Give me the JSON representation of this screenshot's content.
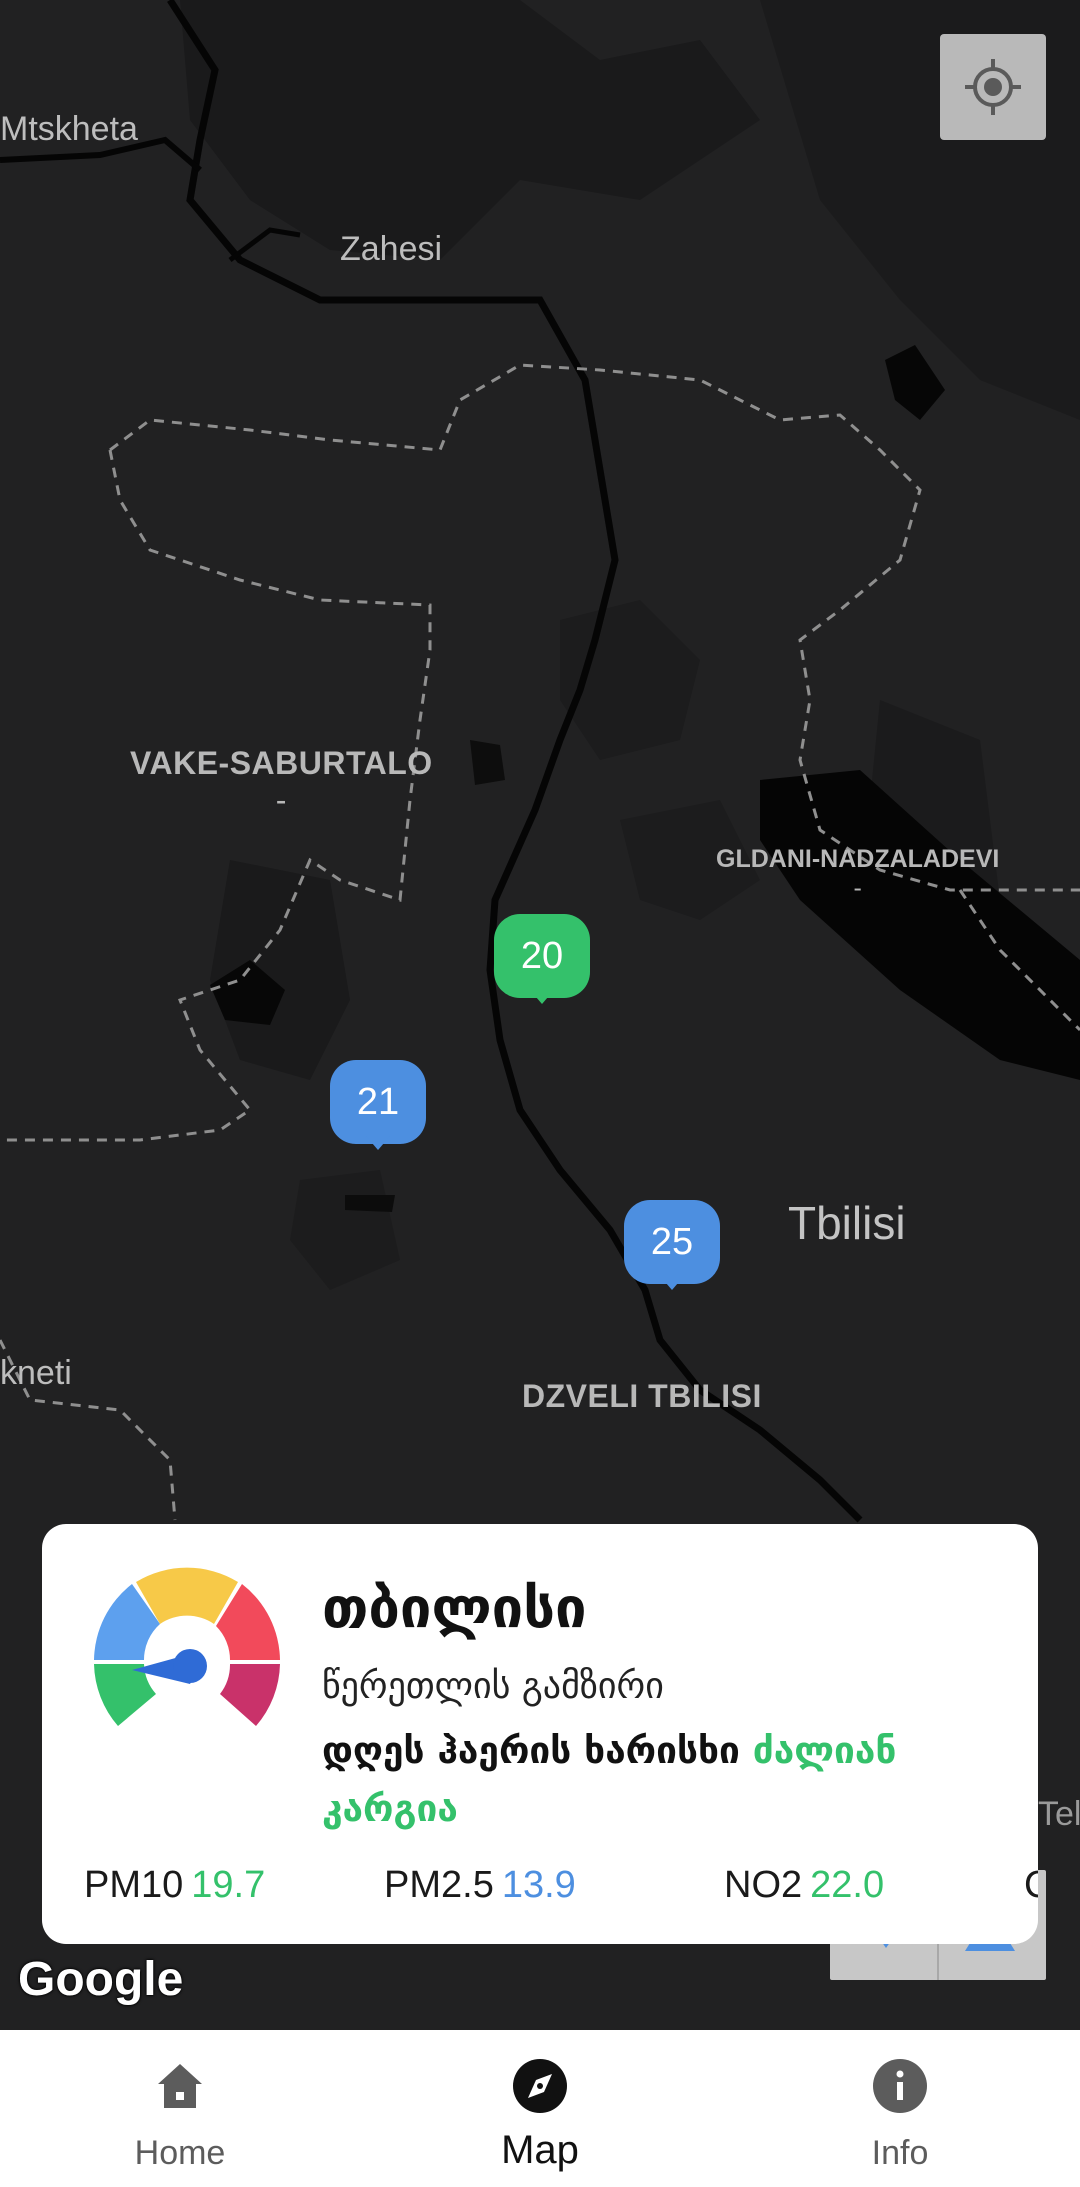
{
  "map": {
    "labels": {
      "mtskheta": "Mtskheta",
      "zahesi": "Zahesi",
      "vake_saburtalo": "VAKE-SABURTALO",
      "vake_saburtalo_dash": "-",
      "gldani_nadzaladevi": "GLDANI-NADZALADEVI",
      "gldani_dash": "-",
      "tbilisi": "Tbilisi",
      "dzveli_tbilisi": "DZVELI TBILISI",
      "kneti": "kneti",
      "tel": "Tel"
    },
    "markers": [
      {
        "value": "20",
        "color": "#34c16b"
      },
      {
        "value": "21",
        "color": "#4d8fe0"
      },
      {
        "value": "25",
        "color": "#4d8fe0"
      }
    ],
    "attribution": "Google"
  },
  "card": {
    "city": "თბილისი",
    "station": "წერეთლის გამზირი",
    "quality_prefix": "დღეს ჰაერის ხარისხი ",
    "quality_value": "ძალიან კარგია",
    "pollutants": [
      {
        "name": "PM10",
        "value": "19.7",
        "color": "#34c16b"
      },
      {
        "name": "PM2.5",
        "value": "13.9",
        "color": "#4d8fe0"
      },
      {
        "name": "NO2",
        "value": "22.0",
        "color": "#34c16b"
      },
      {
        "name": "C",
        "value": "",
        "color": "#1a1a1a"
      }
    ]
  },
  "nav": {
    "items": [
      {
        "label": "Home",
        "icon": "home-icon",
        "active": false
      },
      {
        "label": "Map",
        "icon": "compass-icon",
        "active": true
      },
      {
        "label": "Info",
        "icon": "info-icon",
        "active": false
      }
    ]
  },
  "colors": {
    "good": "#34c16b",
    "moderate": "#4d8fe0",
    "map_bg": "#212122"
  }
}
